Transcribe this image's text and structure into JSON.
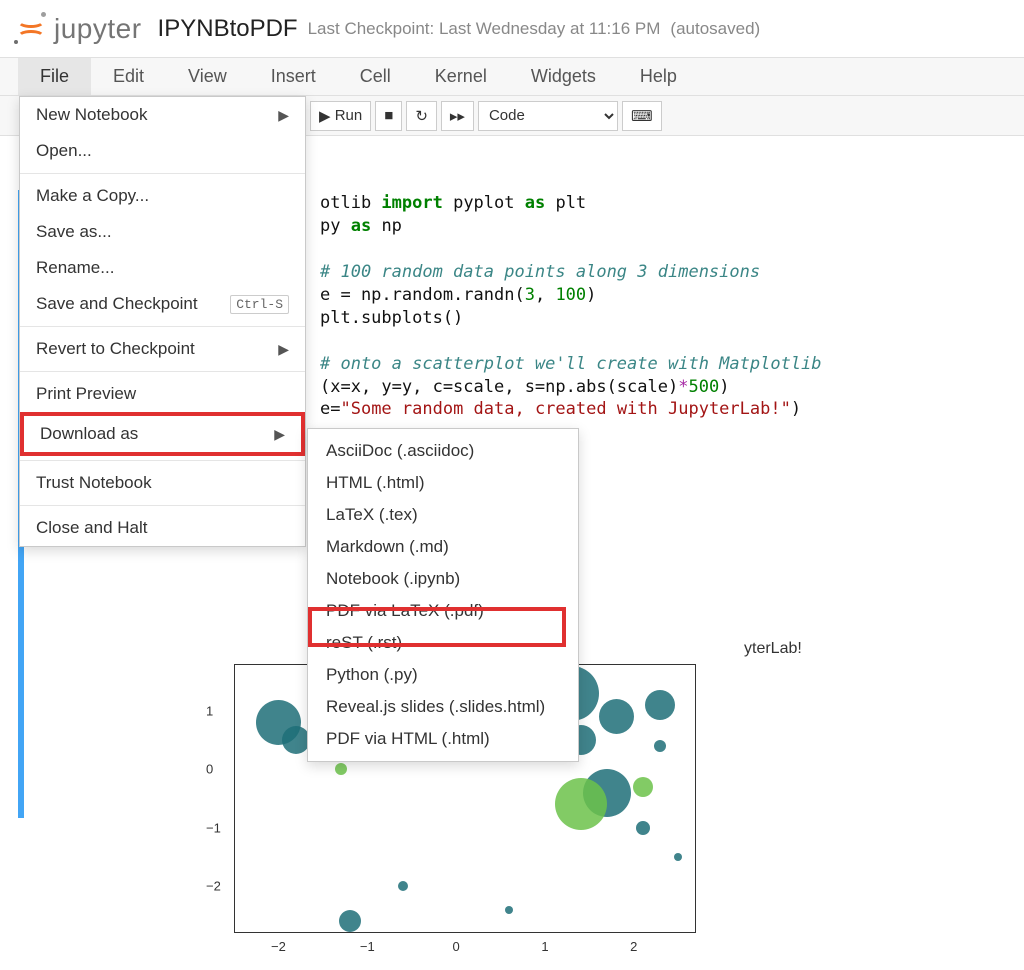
{
  "header": {
    "brand": "jupyter",
    "notebook_title": "IPYNBtoPDF",
    "checkpoint": "Last Checkpoint: Last Wednesday at 11:16 PM",
    "autosaved": "(autosaved)"
  },
  "menubar": [
    "File",
    "Edit",
    "View",
    "Insert",
    "Cell",
    "Kernel",
    "Widgets",
    "Help"
  ],
  "toolbar": {
    "run_label": "Run",
    "cell_type_selected": "Code"
  },
  "file_menu": {
    "items": [
      {
        "label": "New Notebook",
        "has_submenu": true
      },
      {
        "label": "Open..."
      },
      {
        "sep": true
      },
      {
        "label": "Make a Copy..."
      },
      {
        "label": "Save as..."
      },
      {
        "label": "Rename..."
      },
      {
        "label": "Save and Checkpoint",
        "keybinding": "Ctrl-S"
      },
      {
        "sep": true
      },
      {
        "label": "Revert to Checkpoint",
        "has_submenu": true
      },
      {
        "sep": true
      },
      {
        "label": "Print Preview"
      },
      {
        "label": "Download as",
        "has_submenu": true,
        "highlighted": true
      },
      {
        "sep": true
      },
      {
        "label": "Trust Notebook"
      },
      {
        "sep": true
      },
      {
        "label": "Close and Halt"
      }
    ]
  },
  "download_as": {
    "items": [
      "AsciiDoc (.asciidoc)",
      "HTML (.html)",
      "LaTeX (.tex)",
      "Markdown (.md)",
      "Notebook (.ipynb)",
      "PDF via LaTeX (.pdf)",
      "reST (.rst)",
      "Python (.py)",
      "Reveal.js slides (.slides.html)",
      "PDF via HTML (.html)"
    ],
    "highlighted_index": 5
  },
  "code": {
    "lines_visible": [
      {
        "type": "code",
        "text_prefix": "otlib ",
        "kw": "import",
        "rest": " pyplot ",
        "kw2": "as",
        "rest2": " plt"
      },
      {
        "type": "code",
        "text_prefix": "py ",
        "kw": "as",
        "rest": " np"
      },
      {
        "type": "blank"
      },
      {
        "type": "comment",
        "text": " 100 random data points along 3 dimensions"
      },
      {
        "type": "code_plain",
        "text": "e = np.random.randn(3, 100)"
      },
      {
        "type": "code_plain",
        "text": "plt.subplots()"
      },
      {
        "type": "blank"
      },
      {
        "type": "comment",
        "text": " onto a scatterplot we'll create with Matplotlib"
      },
      {
        "type": "code_plain",
        "text": "(x=x, y=y, c=scale, s=np.abs(scale)*500)"
      },
      {
        "type": "code_str",
        "prefix": "e=",
        "str": "\"Some random data, created with JupyterLab!\"",
        "suffix": ")"
      }
    ]
  },
  "chart_data": {
    "type": "scatter",
    "title": "Some random data, created with JupyterLab!",
    "title_visible_fragment": "yterLab!",
    "xlim": [
      -2.5,
      2.7
    ],
    "ylim": [
      -2.8,
      1.8
    ],
    "xticks": [
      -2,
      -1,
      0,
      1,
      2
    ],
    "yticks": [
      -2,
      -1,
      0,
      1
    ],
    "note": "Points estimated from visible pixels; c controls color (teal↔green), s scales radius.",
    "points": [
      {
        "x": -2.0,
        "y": 0.8,
        "size": 45,
        "color": "#1f6f78"
      },
      {
        "x": -1.8,
        "y": 0.5,
        "size": 28,
        "color": "#1f6f78"
      },
      {
        "x": -1.3,
        "y": 0.0,
        "size": 12,
        "color": "#6cc24a"
      },
      {
        "x": -0.6,
        "y": -2.0,
        "size": 10,
        "color": "#1f6f78"
      },
      {
        "x": 1.3,
        "y": 1.3,
        "size": 55,
        "color": "#1f6f78"
      },
      {
        "x": 1.4,
        "y": 0.5,
        "size": 30,
        "color": "#1f6f78"
      },
      {
        "x": 1.8,
        "y": 0.9,
        "size": 35,
        "color": "#1f6f78"
      },
      {
        "x": 2.3,
        "y": 1.1,
        "size": 30,
        "color": "#1f6f78"
      },
      {
        "x": 2.3,
        "y": 0.4,
        "size": 12,
        "color": "#1f6f78"
      },
      {
        "x": 1.7,
        "y": -0.4,
        "size": 48,
        "color": "#1f6f78"
      },
      {
        "x": 1.4,
        "y": -0.6,
        "size": 52,
        "color": "#6cc24a"
      },
      {
        "x": 2.1,
        "y": -0.3,
        "size": 20,
        "color": "#6cc24a"
      },
      {
        "x": 2.1,
        "y": -1.0,
        "size": 14,
        "color": "#1f6f78"
      },
      {
        "x": 2.5,
        "y": -1.5,
        "size": 8,
        "color": "#1f6f78"
      },
      {
        "x": 0.6,
        "y": -2.4,
        "size": 8,
        "color": "#1f6f78"
      },
      {
        "x": -1.2,
        "y": -2.6,
        "size": 22,
        "color": "#1f6f78"
      }
    ]
  }
}
